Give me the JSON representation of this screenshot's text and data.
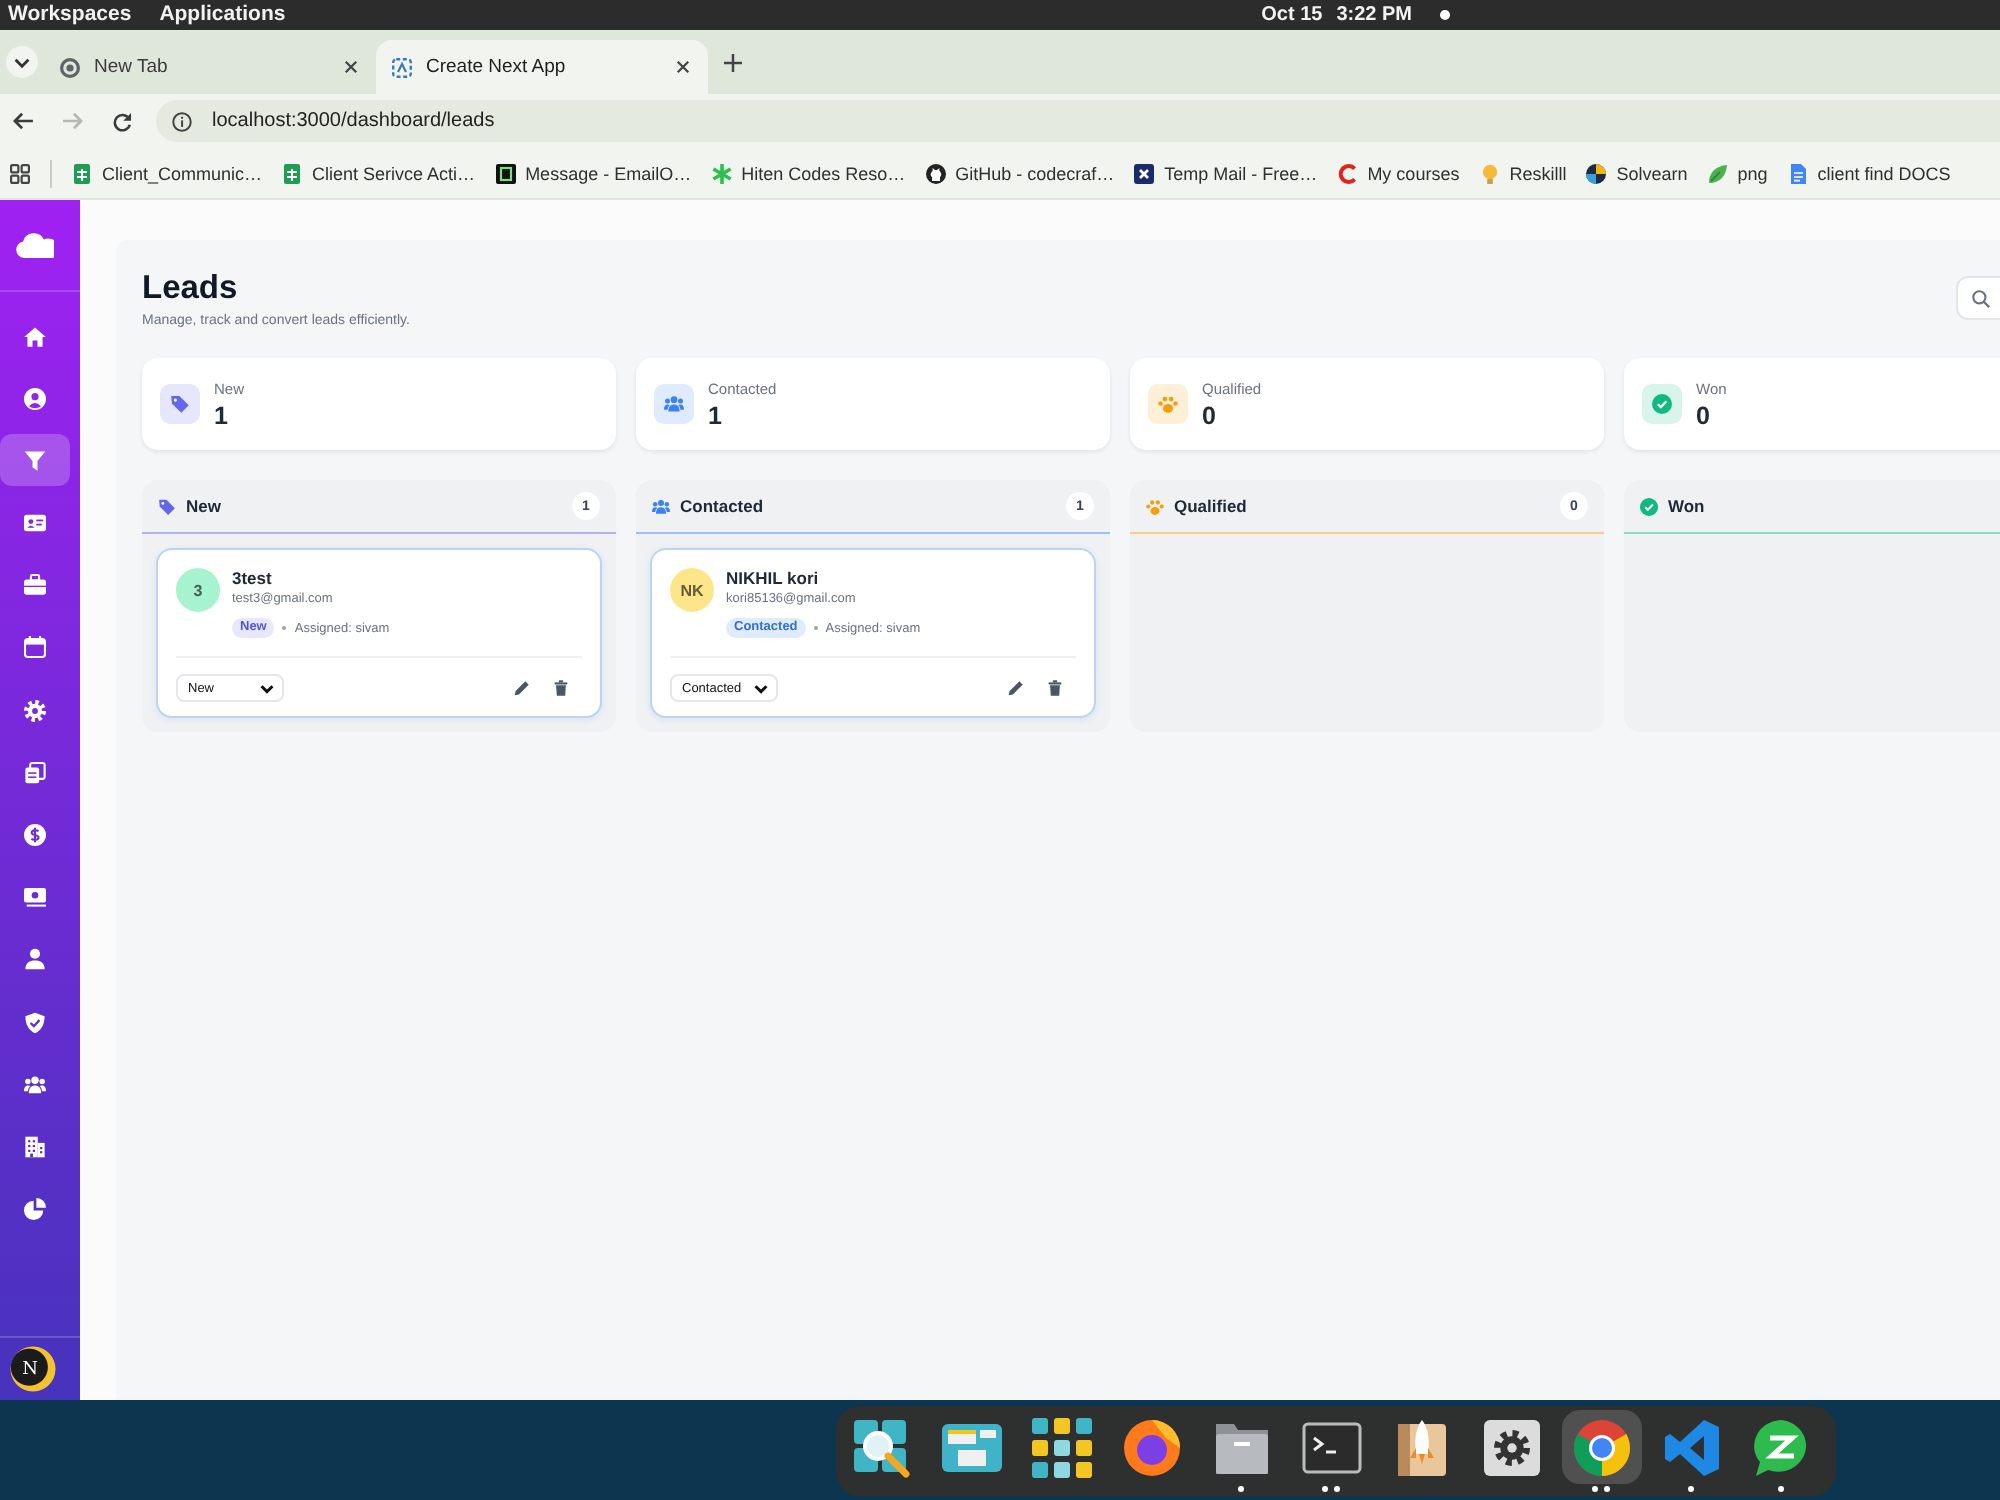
{
  "system_bar": {
    "menus": [
      {
        "label": "Workspaces"
      },
      {
        "label": "Applications"
      }
    ],
    "date": "Oct 15",
    "time": "3:22 PM"
  },
  "browser": {
    "tabs": [
      {
        "title": "New Tab",
        "selected": false
      },
      {
        "title": "Create Next App",
        "selected": true
      }
    ],
    "back_disabled": false,
    "forward_disabled": true,
    "address": "localhost:3000/dashboard/leads",
    "bookmarks": [
      {
        "title": "Client_Communic…"
      },
      {
        "title": "Client Serivce Acti…"
      },
      {
        "title": "Message - EmailO…"
      },
      {
        "title": "Hiten Codes Reso…"
      },
      {
        "title": "GitHub - codecraf…"
      },
      {
        "title": "Temp Mail - Free…"
      },
      {
        "title": "My courses"
      },
      {
        "title": "Reskilll"
      },
      {
        "title": "Solvearn"
      },
      {
        "title": "png"
      },
      {
        "title": "client find DOCS"
      }
    ]
  },
  "sidebar": {
    "items": [
      {
        "selected": false
      },
      {
        "selected": false
      },
      {
        "selected": true
      },
      {
        "selected": false
      },
      {
        "selected": false
      },
      {
        "selected": false
      },
      {
        "selected": false
      },
      {
        "selected": false
      },
      {
        "selected": false
      },
      {
        "selected": false
      },
      {
        "selected": false
      },
      {
        "selected": false
      },
      {
        "selected": false
      },
      {
        "selected": false
      },
      {
        "selected": false
      }
    ],
    "avatar_initial": "N"
  },
  "header": {
    "title": "Leads",
    "subtitle": "Manage, track and convert leads efficiently."
  },
  "stats": [
    {
      "label": "New",
      "value": "1",
      "color": "#6366f1"
    },
    {
      "label": "Contacted",
      "value": "1",
      "color": "#3b82f6"
    },
    {
      "label": "Qualified",
      "value": "0",
      "color": "#f59e0b"
    },
    {
      "label": "Won",
      "value": "0",
      "color": "#10b981"
    }
  ],
  "columns": [
    {
      "title": "New",
      "count": "1",
      "color": "#6366f1",
      "cards": [
        {
          "initials": "3",
          "name": "3test",
          "email": "test3@gmail.com",
          "status": "New",
          "assignee": "Assigned: sivam",
          "stage": "New",
          "color": "#a7f3d0"
        }
      ]
    },
    {
      "title": "Contacted",
      "count": "1",
      "color": "#3b82f6",
      "cards": [
        {
          "initials": "NK",
          "name": "NIKHIL kori",
          "email": "kori85136@gmail.com",
          "status": "Contacted",
          "assignee": "Assigned: sivam",
          "stage": "Contacted",
          "color": "#fde68a"
        }
      ]
    },
    {
      "title": "Qualified",
      "count": "0",
      "color": "#f59e0b"
    },
    {
      "title": "Won",
      "color": "#10b981"
    }
  ],
  "dock": {
    "apps": [
      {
        "selected": false,
        "running": false,
        "multiple_windows": false
      },
      {
        "selected": false,
        "running": false,
        "multiple_windows": false
      },
      {
        "selected": false,
        "running": false,
        "multiple_windows": false
      },
      {
        "selected": false,
        "running": false,
        "multiple_windows": false
      },
      {
        "selected": false,
        "running": true,
        "multiple_windows": false
      },
      {
        "selected": false,
        "running": true,
        "multiple_windows": true
      },
      {
        "selected": false,
        "running": false,
        "multiple_windows": false
      },
      {
        "selected": false,
        "running": false,
        "multiple_windows": false
      },
      {
        "selected": true,
        "running": true,
        "multiple_windows": true
      },
      {
        "selected": false,
        "running": true,
        "multiple_windows": false
      },
      {
        "selected": false,
        "running": true,
        "multiple_windows": false
      }
    ]
  }
}
